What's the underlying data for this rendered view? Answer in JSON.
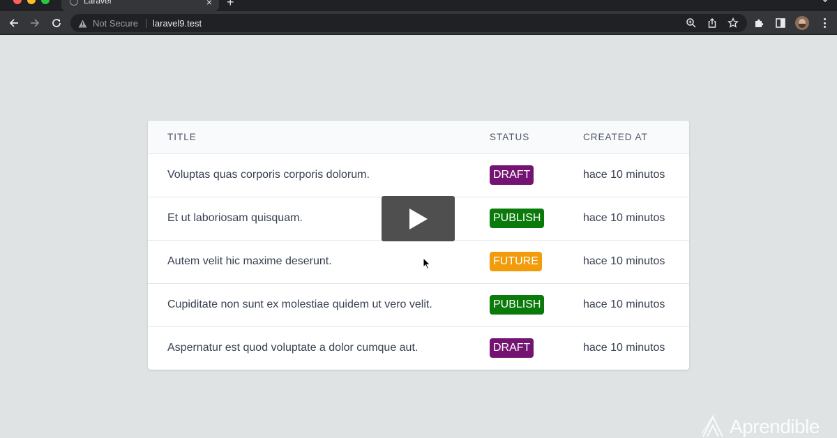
{
  "browser": {
    "tab_title": "Laravel",
    "new_tab_label": "+",
    "close_label": "×",
    "security_label": "Not Secure",
    "url": "laravel9.test"
  },
  "table": {
    "headers": {
      "title": "TITLE",
      "status": "STATUS",
      "created_at": "CREATED AT"
    },
    "rows": [
      {
        "title": "Voluptas quas corporis corporis dolorum.",
        "status": "DRAFT",
        "created_at": "hace 10 minutos"
      },
      {
        "title": "Et ut laboriosam quisquam.",
        "status": "PUBLISH",
        "created_at": "hace 10 minutos"
      },
      {
        "title": "Autem velit hic maxime deserunt.",
        "status": "FUTURE",
        "created_at": "hace 10 minutos"
      },
      {
        "title": "Cupiditate non sunt ex molestiae quidem ut vero velit.",
        "status": "PUBLISH",
        "created_at": "hace 10 minutos"
      },
      {
        "title": "Aspernatur est quod voluptate a dolor cumque aut.",
        "status": "DRAFT",
        "created_at": "hace 10 minutos"
      }
    ]
  },
  "status_colors": {
    "DRAFT": "#741472",
    "PUBLISH": "#0a7a0a",
    "FUTURE": "#f39c0b"
  },
  "watermark": {
    "text": "Aprendible"
  },
  "icons": {
    "play": "play-icon",
    "cursor": "mouse-cursor-icon"
  }
}
